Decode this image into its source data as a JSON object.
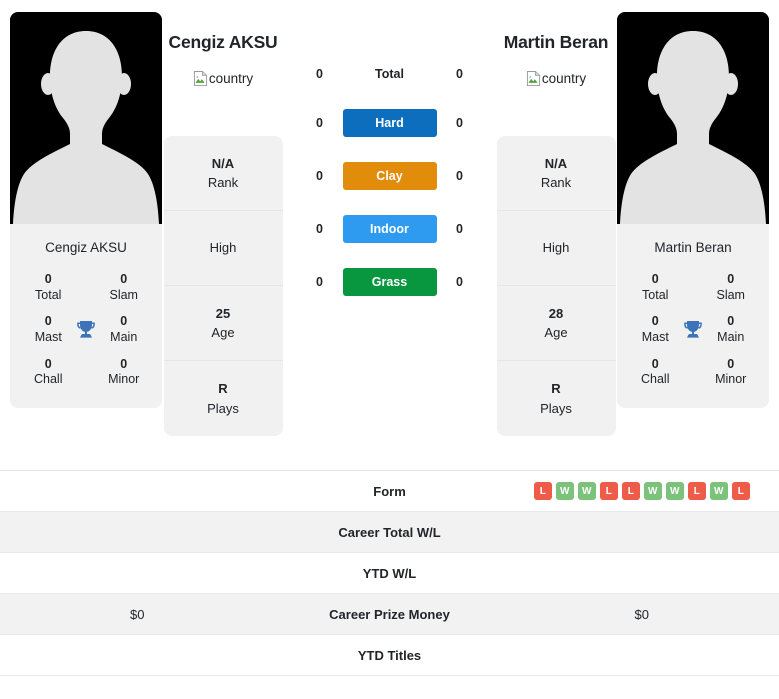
{
  "players": [
    {
      "name": "Cengiz AKSU",
      "flag_alt": "country",
      "photo_caption": "Cengiz AKSU",
      "titles": {
        "total_value": "0",
        "total_label": "Total",
        "slam_value": "0",
        "slam_label": "Slam",
        "mast_value": "0",
        "mast_label": "Mast",
        "main_value": "0",
        "main_label": "Main",
        "chall_value": "0",
        "chall_label": "Chall",
        "minor_value": "0",
        "minor_label": "Minor"
      },
      "info": [
        {
          "value": "N/A",
          "label": "Rank"
        },
        {
          "value": "",
          "label": "High"
        },
        {
          "value": "25",
          "label": "Age"
        },
        {
          "value": "R",
          "label": "Plays"
        }
      ]
    },
    {
      "name": "Martin Beran",
      "flag_alt": "country",
      "photo_caption": "Martin Beran",
      "titles": {
        "total_value": "0",
        "total_label": "Total",
        "slam_value": "0",
        "slam_label": "Slam",
        "mast_value": "0",
        "mast_label": "Mast",
        "main_value": "0",
        "main_label": "Main",
        "chall_value": "0",
        "chall_label": "Chall",
        "minor_value": "0",
        "minor_label": "Minor"
      },
      "info": [
        {
          "value": "N/A",
          "label": "Rank"
        },
        {
          "value": "",
          "label": "High"
        },
        {
          "value": "28",
          "label": "Age"
        },
        {
          "value": "R",
          "label": "Plays"
        }
      ]
    }
  ],
  "surfaces": [
    {
      "label": "Total",
      "left": "0",
      "right": "0",
      "color": "",
      "plain": true
    },
    {
      "label": "Hard",
      "left": "0",
      "right": "0",
      "color": "#0d6ebd",
      "plain": false
    },
    {
      "label": "Clay",
      "left": "0",
      "right": "0",
      "color": "#e28c0b",
      "plain": false
    },
    {
      "label": "Indoor",
      "left": "0",
      "right": "0",
      "color": "#2e9bf0",
      "plain": false
    },
    {
      "label": "Grass",
      "left": "0",
      "right": "0",
      "color": "#08963f",
      "plain": false
    }
  ],
  "table": {
    "rows": [
      {
        "label": "Form",
        "left": "",
        "right": "",
        "shaded": false,
        "type": "form"
      },
      {
        "label": "Career Total W/L",
        "left": "",
        "right": "",
        "shaded": true,
        "type": "text"
      },
      {
        "label": "YTD W/L",
        "left": "",
        "right": "",
        "shaded": false,
        "type": "text"
      },
      {
        "label": "Career Prize Money",
        "left": "$0",
        "right": "$0",
        "shaded": true,
        "type": "text"
      },
      {
        "label": "YTD Titles",
        "left": "",
        "right": "",
        "shaded": false,
        "type": "text"
      }
    ],
    "form_results": [
      "L",
      "W",
      "W",
      "L",
      "L",
      "W",
      "W",
      "L",
      "W",
      "L"
    ]
  },
  "colors": {
    "win": "#7bc27b",
    "loss": "#ef5b49",
    "hard": "#0d6ebd",
    "clay": "#e28c0b",
    "indoor": "#2e9bf0",
    "grass": "#08963f",
    "trophy": "#3c73b9",
    "card_bg": "#f1f1f1"
  }
}
